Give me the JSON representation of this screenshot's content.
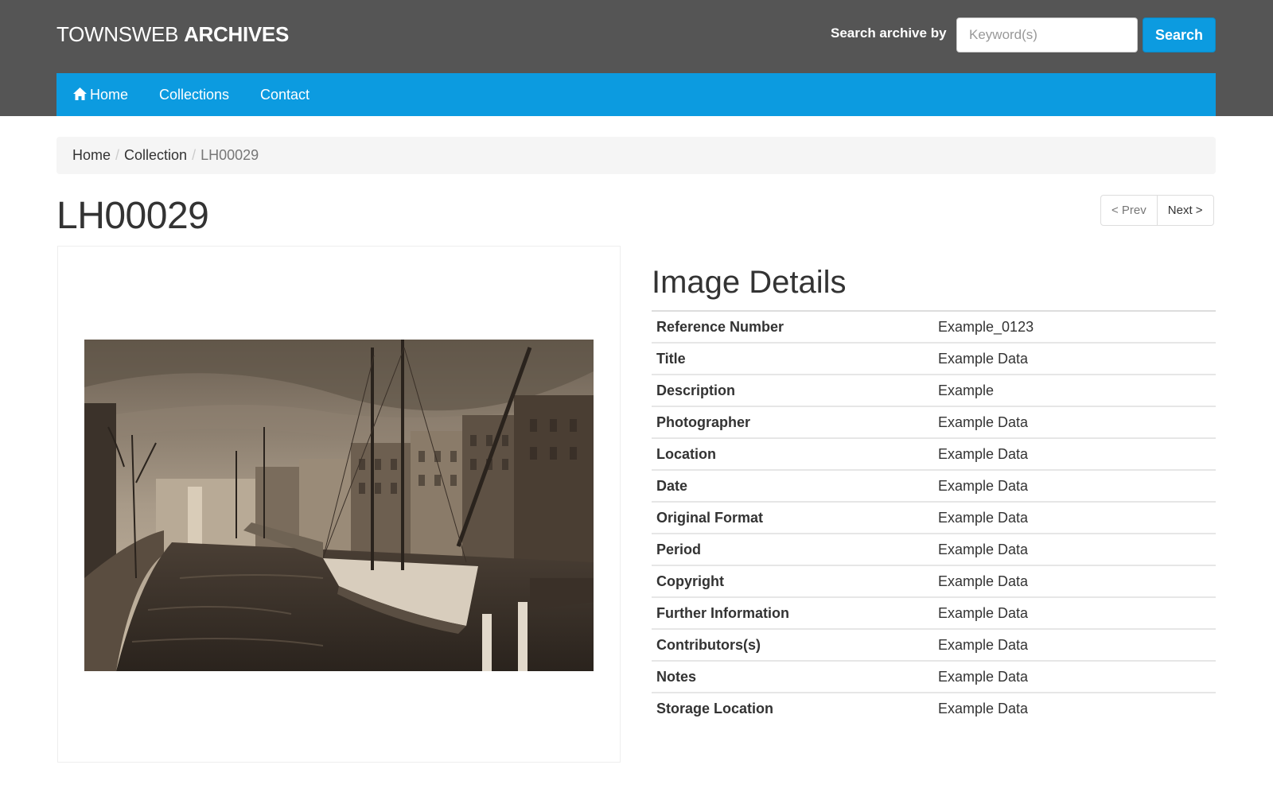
{
  "header": {
    "brand_light": "TOWNSWEB",
    "brand_bold": "ARCHIVES",
    "search_label": "Search archive by",
    "search_placeholder": "Keyword(s)",
    "search_button": "Search"
  },
  "nav": {
    "items": [
      {
        "label": "Home",
        "icon": "home-icon"
      },
      {
        "label": "Collections"
      },
      {
        "label": "Contact"
      }
    ]
  },
  "breadcrumb": [
    {
      "label": "Home"
    },
    {
      "label": "Collection"
    },
    {
      "label": "LH00029"
    }
  ],
  "page": {
    "title": "LH00029",
    "prev_label": "< Prev",
    "next_label": "Next >"
  },
  "details": {
    "heading": "Image Details",
    "rows": [
      {
        "label": "Reference Number",
        "value": "Example_0123"
      },
      {
        "label": "Title",
        "value": "Example Data"
      },
      {
        "label": "Description",
        "value": "Example"
      },
      {
        "label": "Photographer",
        "value": "Example Data"
      },
      {
        "label": "Location",
        "value": "Example Data"
      },
      {
        "label": "Date",
        "value": "Example Data"
      },
      {
        "label": "Original Format",
        "value": "Example Data"
      },
      {
        "label": "Period",
        "value": "Example Data"
      },
      {
        "label": "Copyright",
        "value": "Example Data"
      },
      {
        "label": "Further Information",
        "value": "Example Data"
      },
      {
        "label": "Contributors(s)",
        "value": "Example Data"
      },
      {
        "label": "Notes",
        "value": "Example Data"
      },
      {
        "label": "Storage Location",
        "value": "Example Data"
      }
    ]
  },
  "colors": {
    "header_bg": "#555555",
    "accent": "#0c9be0",
    "breadcrumb_bg": "#f5f5f5"
  }
}
